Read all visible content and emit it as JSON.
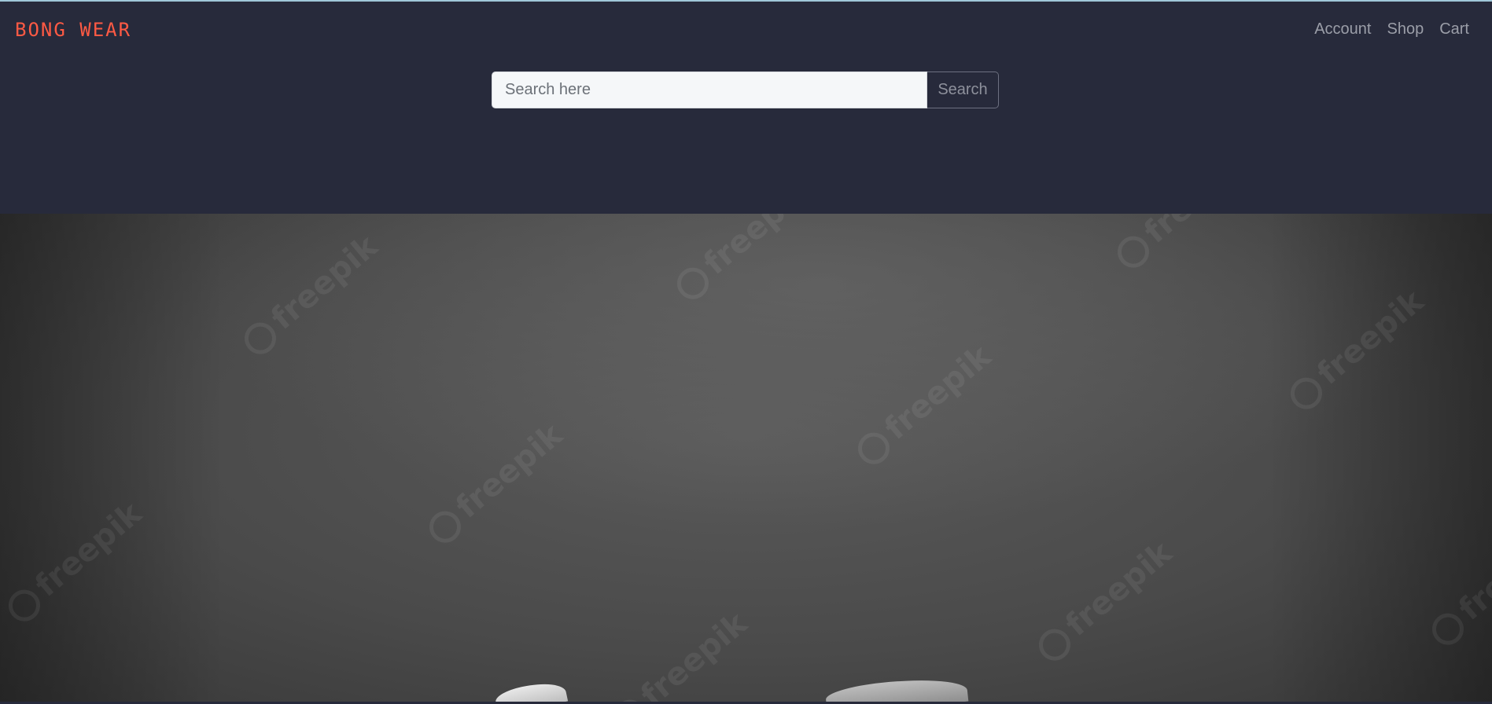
{
  "brand": {
    "name": "BONG WEAR",
    "color": "#ff5a44"
  },
  "nav": {
    "items": [
      {
        "label": "Account"
      },
      {
        "label": "Shop"
      },
      {
        "label": "Cart"
      }
    ]
  },
  "search": {
    "placeholder": "Search here",
    "value": "",
    "button_label": "Search"
  },
  "hero": {
    "watermark_text": "freepik",
    "watermark_icon": "freepik-logo-icon"
  },
  "colors": {
    "header_bg": "#272a3b",
    "nav_text": "#9b9ea8",
    "top_accent": "#9fc7d8"
  }
}
